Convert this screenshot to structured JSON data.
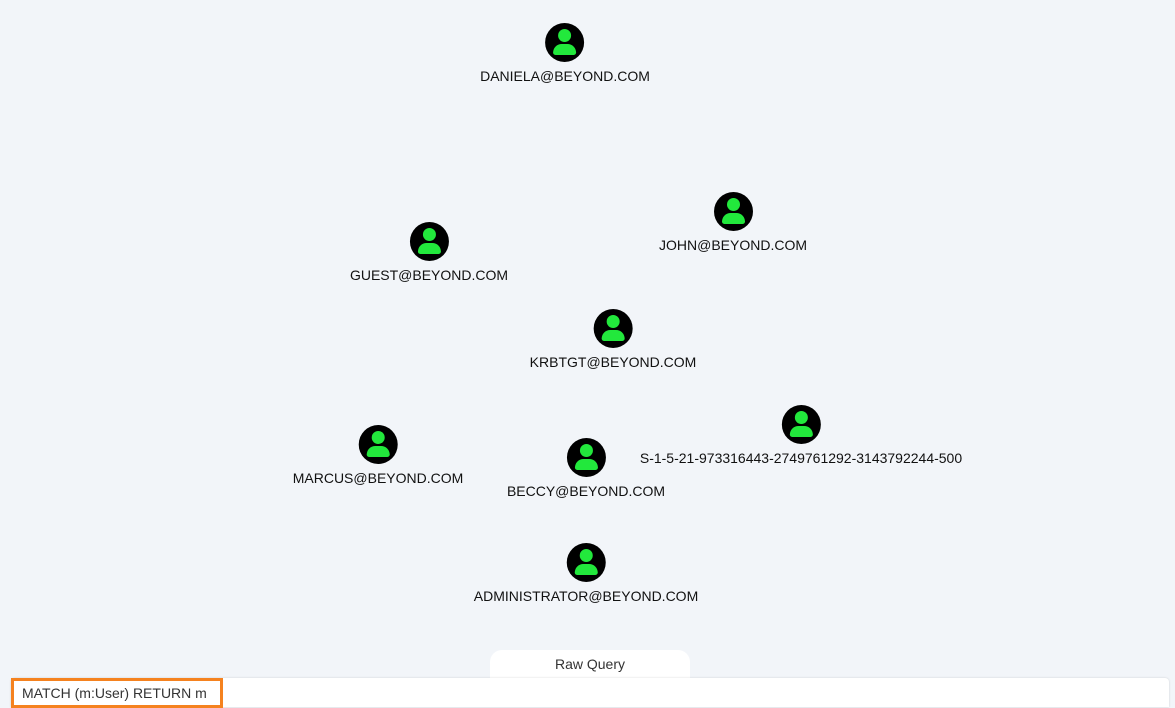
{
  "graph": {
    "node_type": "User",
    "icon": "user-icon",
    "colors": {
      "node_background": "#000000",
      "node_icon": "#22e83c",
      "label": "#111111"
    },
    "nodes": [
      {
        "label": "DANIELA@BEYOND.COM"
      },
      {
        "label": "JOHN@BEYOND.COM"
      },
      {
        "label": "GUEST@BEYOND.COM"
      },
      {
        "label": "KRBTGT@BEYOND.COM"
      },
      {
        "label": "S-1-5-21-973316443-2749761292-3143792244-500"
      },
      {
        "label": "MARCUS@BEYOND.COM"
      },
      {
        "label": "BECCY@BEYOND.COM"
      },
      {
        "label": "ADMINISTRATOR@BEYOND.COM"
      }
    ]
  },
  "raw_query": {
    "tab_label": "Raw Query",
    "value": "MATCH (m:User) RETURN m",
    "focus_color": "#f5821f"
  }
}
